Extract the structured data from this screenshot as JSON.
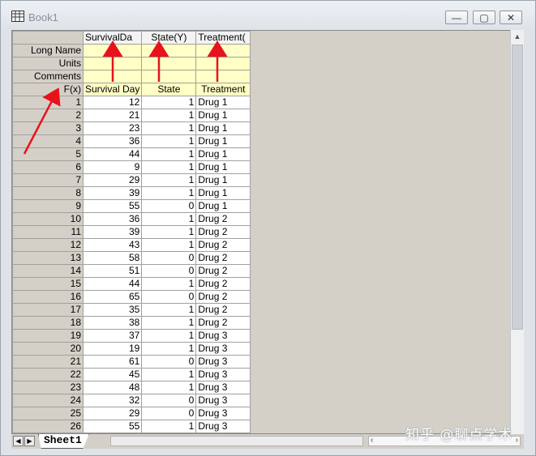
{
  "window": {
    "title": "Book1",
    "min_glyph": "—",
    "max_glyph": "▢",
    "close_glyph": "✕"
  },
  "columns": [
    {
      "short_name": "SurvivalDa",
      "long_name": "",
      "units": "",
      "comments": "",
      "fx": "Survival Day"
    },
    {
      "short_name": "State(Y)",
      "long_name": "",
      "units": "",
      "comments": "",
      "fx": "State"
    },
    {
      "short_name": "Treatment(",
      "long_name": "",
      "units": "",
      "comments": "",
      "fx": "Treatment"
    }
  ],
  "row_labels": {
    "long_name": "Long Name",
    "units": "Units",
    "comments": "Comments",
    "fx": "F(x)"
  },
  "rows": [
    {
      "n": "1",
      "v": [
        "12",
        "1",
        "Drug 1"
      ]
    },
    {
      "n": "2",
      "v": [
        "21",
        "1",
        "Drug 1"
      ]
    },
    {
      "n": "3",
      "v": [
        "23",
        "1",
        "Drug 1"
      ]
    },
    {
      "n": "4",
      "v": [
        "36",
        "1",
        "Drug 1"
      ]
    },
    {
      "n": "5",
      "v": [
        "44",
        "1",
        "Drug 1"
      ]
    },
    {
      "n": "6",
      "v": [
        "9",
        "1",
        "Drug 1"
      ]
    },
    {
      "n": "7",
      "v": [
        "29",
        "1",
        "Drug 1"
      ]
    },
    {
      "n": "8",
      "v": [
        "39",
        "1",
        "Drug 1"
      ]
    },
    {
      "n": "9",
      "v": [
        "55",
        "0",
        "Drug 1"
      ]
    },
    {
      "n": "10",
      "v": [
        "36",
        "1",
        "Drug 2"
      ]
    },
    {
      "n": "11",
      "v": [
        "39",
        "1",
        "Drug 2"
      ]
    },
    {
      "n": "12",
      "v": [
        "43",
        "1",
        "Drug 2"
      ]
    },
    {
      "n": "13",
      "v": [
        "58",
        "0",
        "Drug 2"
      ]
    },
    {
      "n": "14",
      "v": [
        "51",
        "0",
        "Drug 2"
      ]
    },
    {
      "n": "15",
      "v": [
        "44",
        "1",
        "Drug 2"
      ]
    },
    {
      "n": "16",
      "v": [
        "65",
        "0",
        "Drug 2"
      ]
    },
    {
      "n": "17",
      "v": [
        "35",
        "1",
        "Drug 2"
      ]
    },
    {
      "n": "18",
      "v": [
        "38",
        "1",
        "Drug 2"
      ]
    },
    {
      "n": "19",
      "v": [
        "37",
        "1",
        "Drug 3"
      ]
    },
    {
      "n": "20",
      "v": [
        "19",
        "1",
        "Drug 3"
      ]
    },
    {
      "n": "21",
      "v": [
        "61",
        "0",
        "Drug 3"
      ]
    },
    {
      "n": "22",
      "v": [
        "45",
        "1",
        "Drug 3"
      ]
    },
    {
      "n": "23",
      "v": [
        "48",
        "1",
        "Drug 3"
      ]
    },
    {
      "n": "24",
      "v": [
        "32",
        "0",
        "Drug 3"
      ]
    },
    {
      "n": "25",
      "v": [
        "29",
        "0",
        "Drug 3"
      ]
    },
    {
      "n": "26",
      "v": [
        "55",
        "1",
        "Drug 3"
      ]
    }
  ],
  "sheet_tab": {
    "label": "Sheet1"
  },
  "nav": {
    "prev": "◀",
    "next": "▶"
  },
  "scroll": {
    "left": "‹",
    "right": "›",
    "up": "▲"
  },
  "watermark": "知乎 @聊点学术",
  "colors": {
    "annotation_arrow": "#e8121b",
    "label_row_fill": "#ffffc6"
  }
}
